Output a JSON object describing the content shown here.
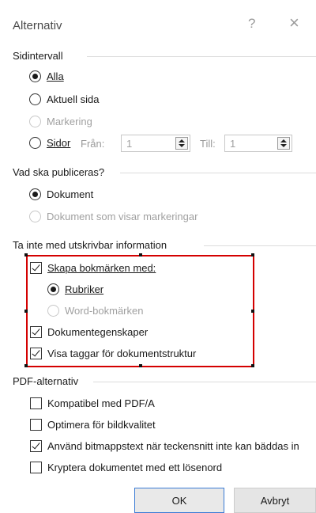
{
  "dialog": {
    "title": "Alternativ",
    "help_glyph": "?",
    "close_glyph": "×"
  },
  "page_range": {
    "label": "Sidintervall",
    "options": [
      {
        "label": "Alla",
        "checked": true,
        "disabled": false
      },
      {
        "label": "Aktuell sida",
        "checked": false,
        "disabled": false
      },
      {
        "label": "Markering",
        "checked": false,
        "disabled": true
      },
      {
        "label": "Sidor",
        "checked": false,
        "disabled": false
      }
    ],
    "from_label": "Från:",
    "from_value": "1",
    "to_label": "Till:",
    "to_value": "1"
  },
  "publish": {
    "label": "Vad ska publiceras?",
    "options": [
      {
        "label": "Dokument",
        "checked": true,
        "disabled": false
      },
      {
        "label": "Dokument som visar markeringar",
        "checked": false,
        "disabled": true
      }
    ]
  },
  "nonprint": {
    "label": "Ta inte med utskrivbar information",
    "create_bookmarks": {
      "label": "Skapa bokmärken med:",
      "checked": true
    },
    "headings": {
      "label": "Rubriker",
      "checked": true
    },
    "word_bookmarks": {
      "label": "Word-bokmärken",
      "checked": false,
      "disabled": true
    },
    "doc_properties": {
      "label": "Dokumentegenskaper",
      "checked": true
    },
    "structure_tags": {
      "label": "Visa taggar för dokumentstruktur",
      "checked": true
    }
  },
  "pdf": {
    "label": "PDF-alternativ",
    "options": [
      {
        "label": "Kompatibel med PDF/A",
        "checked": false
      },
      {
        "label": "Optimera för bildkvalitet",
        "checked": false
      },
      {
        "label": "Använd bitmappstext när teckensnitt inte kan bäddas in",
        "checked": true
      },
      {
        "label": "Kryptera dokumentet med ett lösenord",
        "checked": false
      }
    ]
  },
  "buttons": {
    "ok": "OK",
    "cancel": "Avbryt"
  },
  "colors": {
    "highlight_box": "#d40000",
    "primary_border": "#3a7bd5"
  }
}
